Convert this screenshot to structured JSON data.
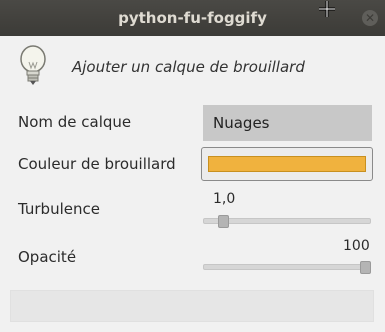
{
  "window": {
    "title": "python-fu-foggify",
    "close_glyph": "✕"
  },
  "header": {
    "icon": "lightbulb-icon",
    "description": "Ajouter un calque de brouillard"
  },
  "fields": {
    "layer_name": {
      "label": "Nom de calque",
      "value": "Nuages"
    },
    "fog_color": {
      "label": "Couleur de brouillard",
      "color": "#f0b23e"
    },
    "turbulence": {
      "label": "Turbulence",
      "value_text": "1,0",
      "fraction": 0.02
    },
    "opacity": {
      "label": "Opacité",
      "value_text": "100",
      "fraction": 1.0
    }
  }
}
